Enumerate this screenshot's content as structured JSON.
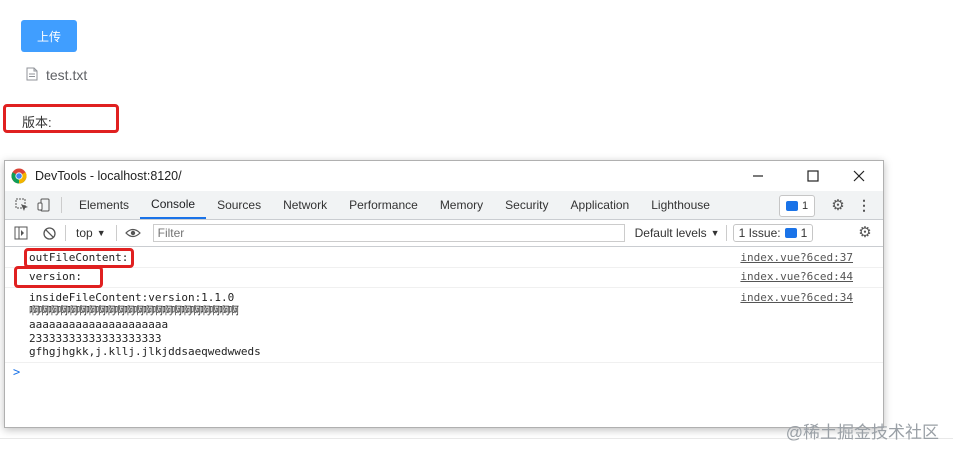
{
  "page": {
    "upload_label": "上传",
    "file_name": "test.txt",
    "version_label": "版本:"
  },
  "devtools": {
    "title": "DevTools - localhost:8120/",
    "tabs": [
      "Elements",
      "Console",
      "Sources",
      "Network",
      "Performance",
      "Memory",
      "Security",
      "Application",
      "Lighthouse"
    ],
    "issues_badge": "1",
    "context": "top",
    "filter_placeholder": "Filter",
    "levels": "Default levels",
    "issue_label": "1 Issue:",
    "issue_count": "1"
  },
  "console": {
    "messages": [
      {
        "lines": [
          "outFileContent:"
        ],
        "source": "index.vue?6ced:37"
      },
      {
        "lines": [
          "version:"
        ],
        "source": "index.vue?6ced:44"
      },
      {
        "lines": [
          "insideFileContent:version:1.1.0",
          "啊啊啊啊啊啊啊啊啊啊啊啊啊啊啊啊啊啊啊啊啊啊",
          "aaaaaaaaaaaaaaaaaaaaa",
          "23333333333333333333",
          "gfhgjhgkk,j.kllj.jlkjddsaeqwedwweds"
        ],
        "source": "index.vue?6ced:34"
      }
    ],
    "prompt": ">"
  },
  "watermark": "@稀土掘金技术社区",
  "colors": {
    "accent": "#409eff",
    "highlight": "#e02020",
    "devtools_blue": "#1a73e8"
  }
}
